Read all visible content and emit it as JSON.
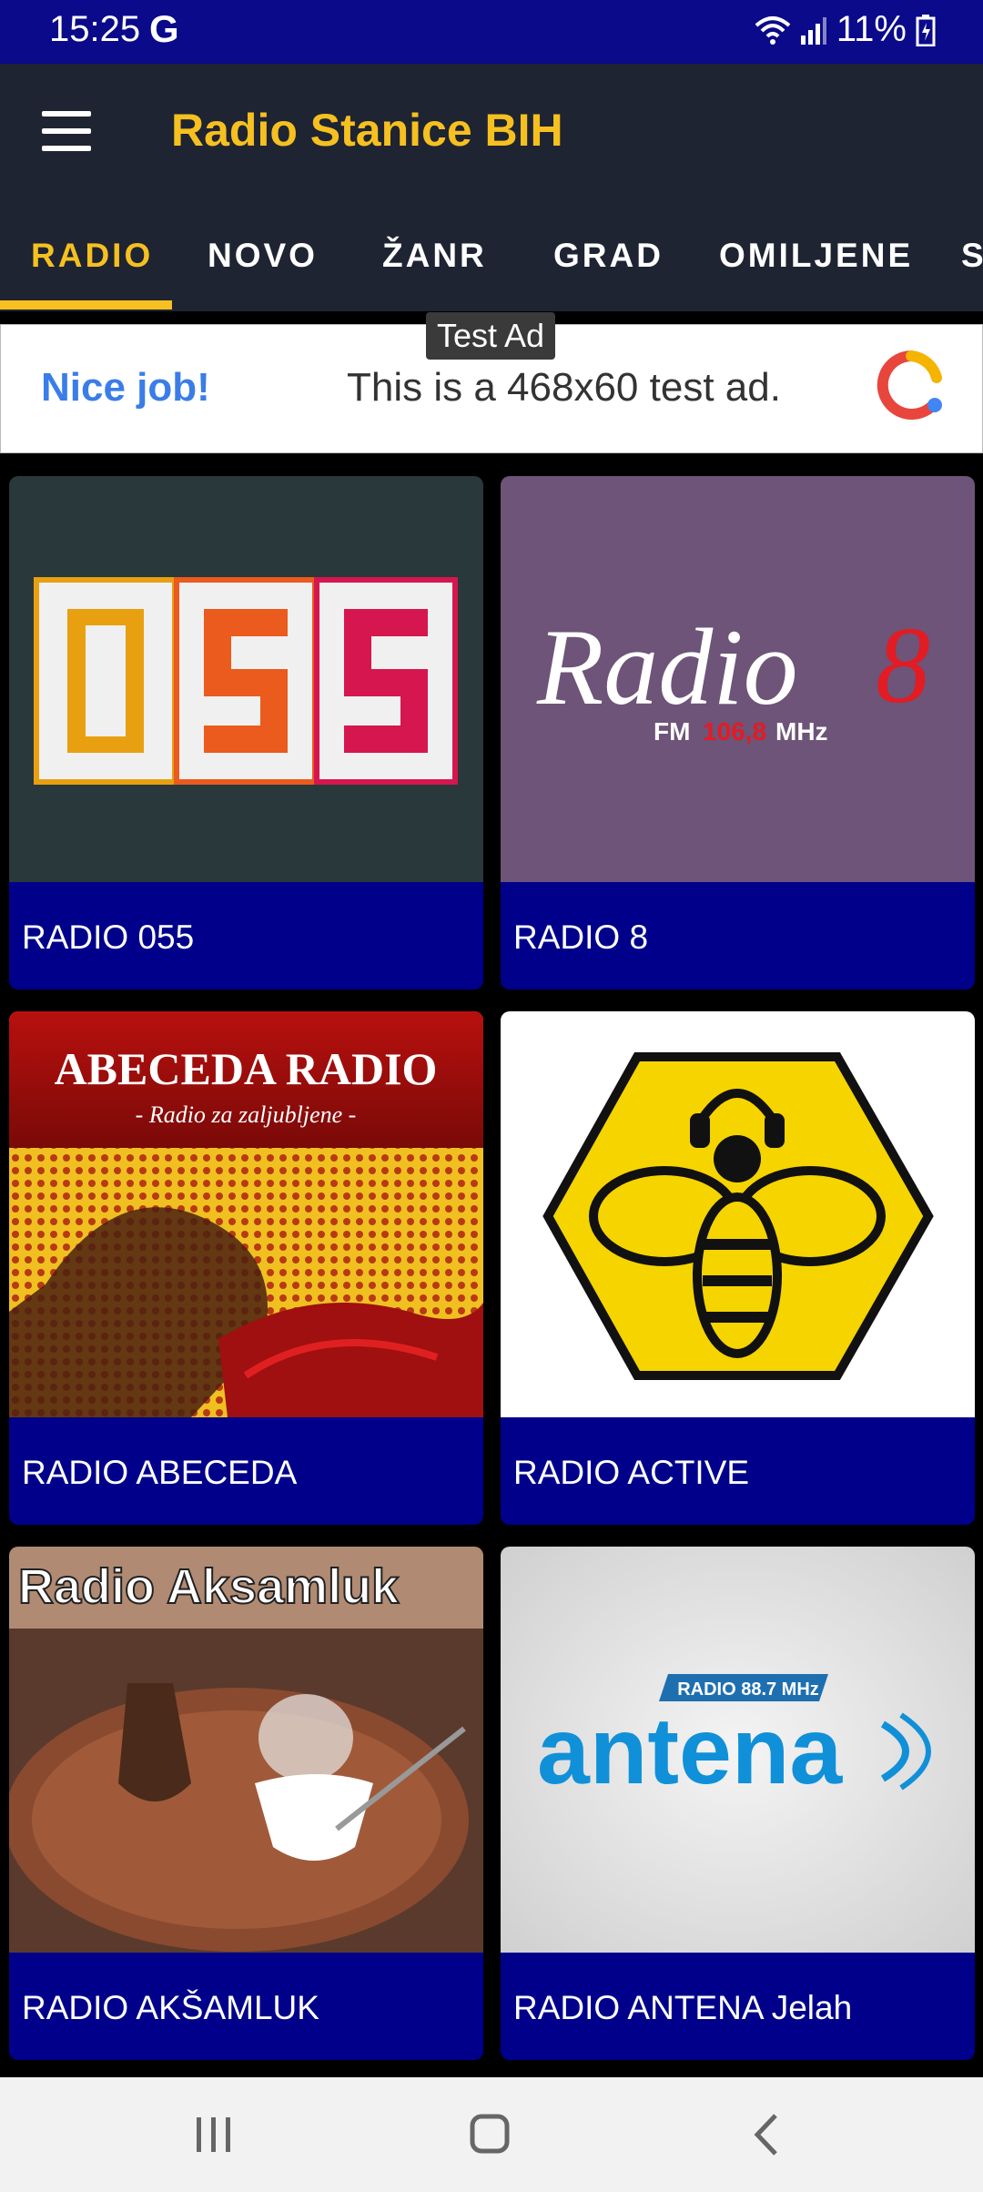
{
  "status": {
    "time": "15:25",
    "g_icon": "G",
    "battery": "11%"
  },
  "app": {
    "title": "Radio Stanice BIH"
  },
  "tabs": [
    {
      "label": "RADIO"
    },
    {
      "label": "NOVO"
    },
    {
      "label": "ŽANR"
    },
    {
      "label": "GRAD"
    },
    {
      "label": "OMILJENE"
    },
    {
      "label": "S"
    }
  ],
  "ad": {
    "label": "Test Ad",
    "nice": "Nice job!",
    "text": "This is a 468x60 test ad."
  },
  "stations": [
    {
      "name": "RADIO 055",
      "art_text": "055"
    },
    {
      "name": "RADIO 8",
      "art_title": "Radio",
      "art_num": "8",
      "art_fm": "FM",
      "art_freq": "106,8",
      "art_mhz": "MHz"
    },
    {
      "name": "RADIO ABECEDA",
      "art_title": "ABECEDA RADIO",
      "art_sub": "- Radio za zaljubljene -"
    },
    {
      "name": "RADIO ACTIVE"
    },
    {
      "name": "RADIO AKŠAMLUK",
      "art_title": "Radio Aksamluk"
    },
    {
      "name": "RADIO ANTENA Jelah",
      "art_tag": "RADIO 88.7 MHz",
      "art_title": "antena"
    }
  ],
  "colors": {
    "status_bar": "#0a0a8a",
    "app_bar": "#1f2433",
    "accent": "#f5c020",
    "label_bar": "#00008b"
  }
}
